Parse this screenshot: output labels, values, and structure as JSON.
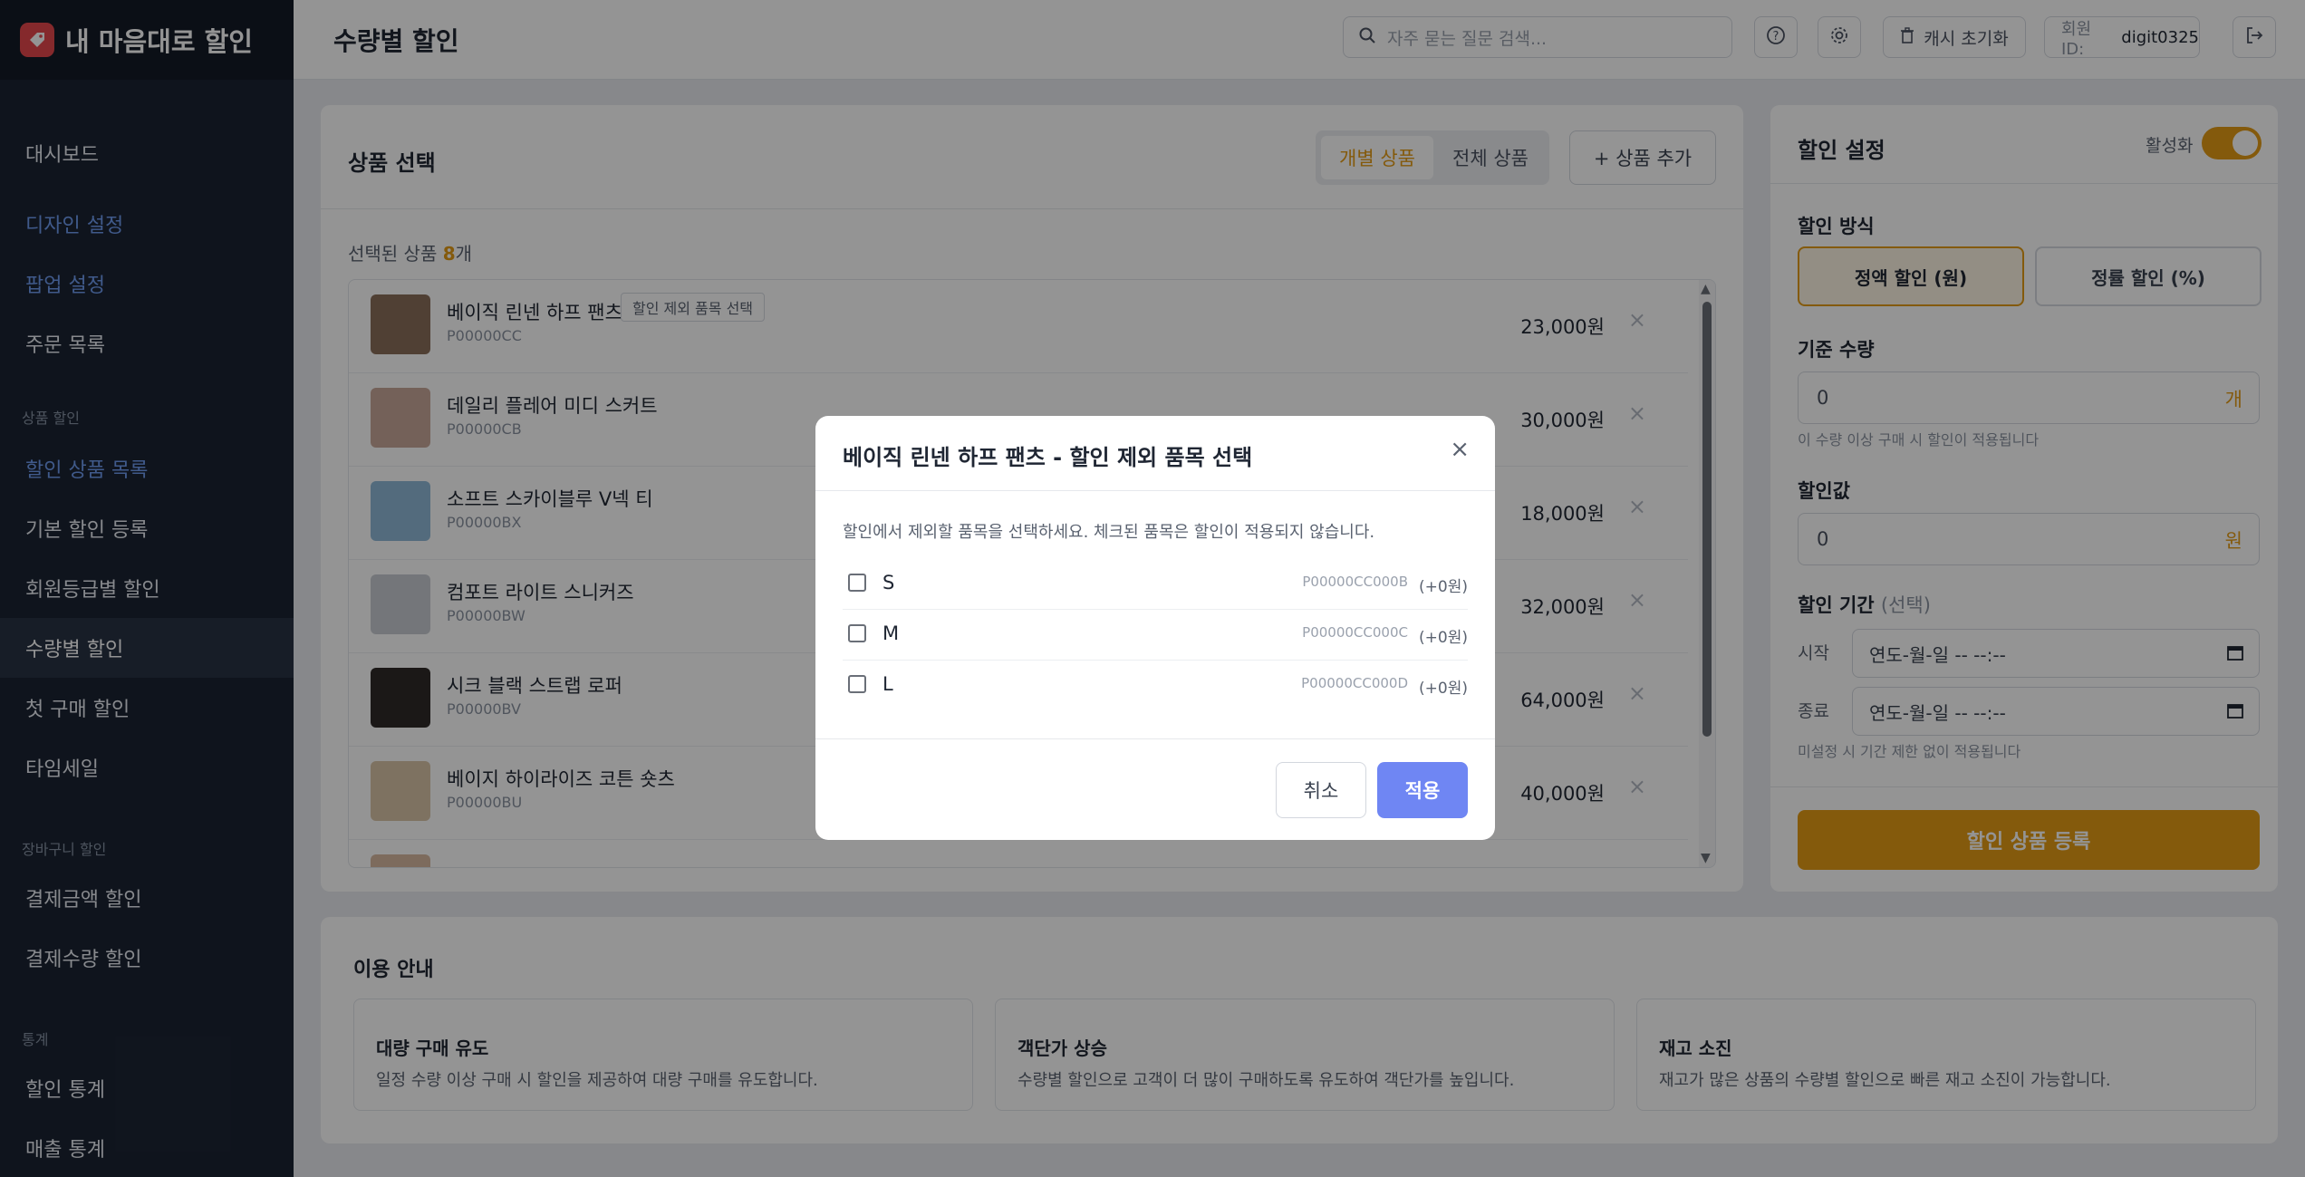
{
  "app": {
    "title": "내 마음대로 할인"
  },
  "sidebar": {
    "items": [
      {
        "label": "대시보드"
      },
      {
        "label": "디자인 설정"
      },
      {
        "label": "팝업 설정"
      },
      {
        "label": "주문 목록"
      },
      {
        "label": "할인 상품 목록"
      },
      {
        "label": "기본 할인 등록"
      },
      {
        "label": "회원등급별 할인"
      },
      {
        "label": "수량별 할인"
      },
      {
        "label": "첫 구매 할인"
      },
      {
        "label": "타임세일"
      },
      {
        "label": "결제금액 할인"
      },
      {
        "label": "결제수량 할인"
      },
      {
        "label": "할인 통계"
      },
      {
        "label": "매출 통계"
      }
    ],
    "sections": [
      {
        "label": "상품 할인"
      },
      {
        "label": "장바구니 할인"
      },
      {
        "label": "통계"
      }
    ]
  },
  "header": {
    "title": "수량별 할인",
    "search_placeholder": "자주 묻는 질문 검색...",
    "cache_reset": "캐시 초기화",
    "member_id_label": "회원 ID:",
    "member_id": "digit0325"
  },
  "product_panel": {
    "title": "상품 선택",
    "tab_individual": "개별 상품",
    "tab_all": "전체 상품",
    "add_button": "+ 상품 추가",
    "selected_prefix": "선택된 상품",
    "selected_count": "8",
    "selected_suffix": "개",
    "products": [
      {
        "name": "베이직 린넨 하프 팬츠",
        "code": "P00000CC",
        "price": "23,000원",
        "tag": "할인 제외 품목 선택"
      },
      {
        "name": "데일리 플레어 미디 스커트",
        "code": "P00000CB",
        "price": "30,000원"
      },
      {
        "name": "소프트 스카이블루 V넥 티",
        "code": "P00000BX",
        "price": "18,000원"
      },
      {
        "name": "컴포트 라이트 스니커즈",
        "code": "P00000BW",
        "price": "32,000원"
      },
      {
        "name": "시크 블랙 스트랩 로퍼",
        "code": "P00000BV",
        "price": "64,000원"
      },
      {
        "name": "베이지 하이라이즈 코튼 숏츠",
        "code": "P00000BU",
        "price": "40,000원"
      }
    ],
    "thumb_colors": [
      "#8b6f5a",
      "#c9a79a",
      "#8fb8d8",
      "#c9ccd2",
      "#2f2a28",
      "#d9c4a8",
      "#d8b8a0"
    ]
  },
  "settings": {
    "title": "할인 설정",
    "active_label": "활성화",
    "method_label": "할인 방식",
    "method_fixed": "정액 할인 (원)",
    "method_rate": "정률 할인 (%)",
    "qty_label": "기준 수량",
    "qty_value": "0",
    "qty_unit": "개",
    "qty_hint": "이 수량 이상 구매 시 할인이 적용됩니다",
    "value_label": "할인값",
    "value_value": "0",
    "value_unit": "원",
    "period_label": "할인 기간",
    "period_optional": "(선택)",
    "start_label": "시작",
    "end_label": "종료",
    "date_placeholder": "연도-월-일  --  --:--",
    "period_hint": "미설정 시 기간 제한 없이 적용됩니다",
    "submit": "할인 상품 등록"
  },
  "guide": {
    "title": "이용 안내",
    "cards": [
      {
        "title": "대량 구매 유도",
        "desc": "일정 수량 이상 구매 시 할인을 제공하여 대량 구매를 유도합니다."
      },
      {
        "title": "객단가 상승",
        "desc": "수량별 할인으로 고객이 더 많이 구매하도록 유도하여 객단가를 높입니다."
      },
      {
        "title": "재고 소진",
        "desc": "재고가 많은 상품의 수량별 할인으로 빠른 재고 소진이 가능합니다."
      }
    ]
  },
  "modal": {
    "title": "베이직 린넨 하프 팬츠 - 할인 제외 품목 선택",
    "description": "할인에서 제외할 품목을 선택하세요. 체크된 품목은 할인이 적용되지 않습니다.",
    "options": [
      {
        "name": "S",
        "code": "P00000CC000B",
        "extra": "(+0원)"
      },
      {
        "name": "M",
        "code": "P00000CC000C",
        "extra": "(+0원)"
      },
      {
        "name": "L",
        "code": "P00000CC000D",
        "extra": "(+0원)"
      }
    ],
    "cancel": "취소",
    "apply": "적용"
  },
  "colors": {
    "accent": "#e39b16",
    "sidebar_bg": "#1b2433",
    "modal_primary": "#6f86f3",
    "link": "#6e9cf0"
  }
}
